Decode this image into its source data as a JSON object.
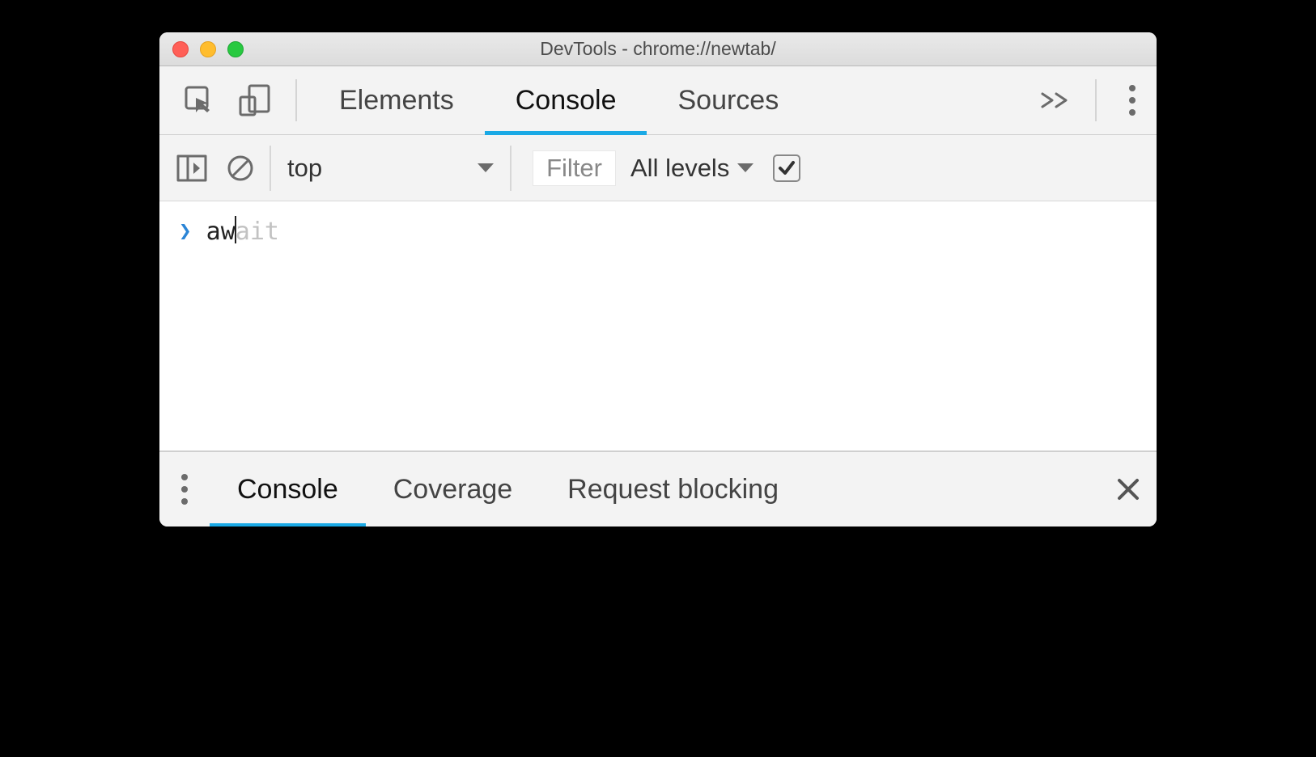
{
  "window": {
    "title": "DevTools - chrome://newtab/"
  },
  "tabs": {
    "elements": "Elements",
    "console": "Console",
    "sources": "Sources"
  },
  "tabs_active": "console",
  "toolbar": {
    "context": "top",
    "filter_placeholder": "Filter",
    "levels_label": "All levels"
  },
  "console": {
    "typed": "aw",
    "suggestion_suffix": "ait"
  },
  "drawer": {
    "console": "Console",
    "coverage": "Coverage",
    "request_blocking": "Request blocking"
  },
  "drawer_active": "console"
}
